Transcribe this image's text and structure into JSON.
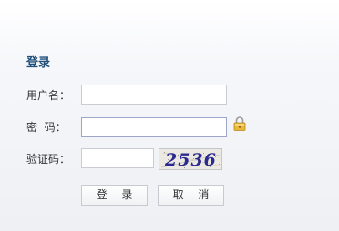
{
  "form": {
    "title": "登录",
    "username_label": "用户名：",
    "password_label": "密  码：",
    "captcha_label": "验证码：",
    "username_value": "",
    "password_value": "",
    "captcha_value": "",
    "captcha_image_text": "2536",
    "login_button": "登 录",
    "cancel_button": "取 消"
  },
  "icons": {
    "password_hint": "lock-icon"
  },
  "colors": {
    "title": "#1f4e79",
    "captcha_text": "#2b2a8f",
    "lock": "#e8b838"
  }
}
